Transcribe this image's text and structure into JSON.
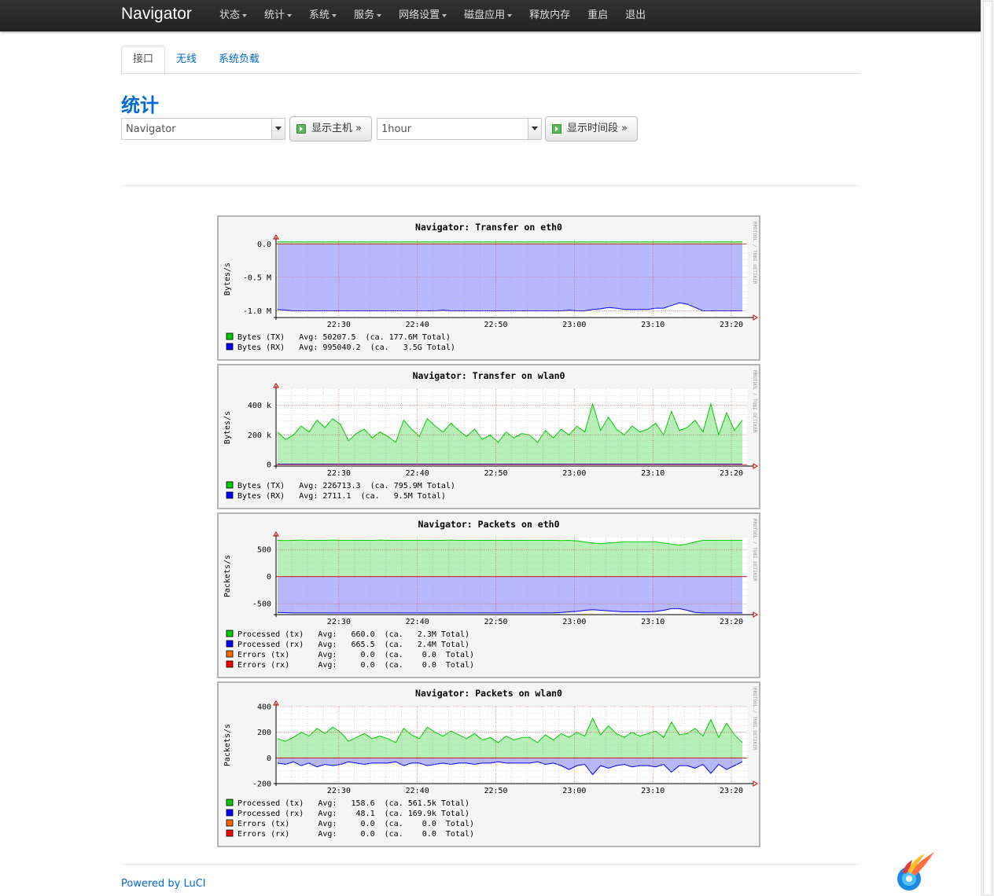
{
  "navbar": {
    "brand": "Navigator",
    "menu": [
      {
        "label": "状态",
        "dropdown": true
      },
      {
        "label": "统计",
        "dropdown": true
      },
      {
        "label": "系统",
        "dropdown": true
      },
      {
        "label": "服务",
        "dropdown": true
      },
      {
        "label": "网络设置",
        "dropdown": true
      },
      {
        "label": "磁盘应用",
        "dropdown": true
      },
      {
        "label": "释放内存",
        "dropdown": false
      },
      {
        "label": "重启",
        "dropdown": false
      },
      {
        "label": "退出",
        "dropdown": false
      }
    ]
  },
  "tabs": [
    {
      "label": "接口",
      "active": true
    },
    {
      "label": "无线",
      "active": false
    },
    {
      "label": "系统负载",
      "active": false
    }
  ],
  "page_title": "统计",
  "controls": {
    "host_select": "Navigator",
    "show_host_button": "显示主机 »",
    "timespan_select": "1hour",
    "show_timespan_button": "显示时间段 »"
  },
  "footer": {
    "powered_by": "Powered by LuCI"
  },
  "colors": {
    "accent": "#0069d6",
    "tx": "#00cc00",
    "rx": "#0000ff",
    "err_tx": "#ff6600",
    "err_rx": "#ff0000"
  },
  "chart_data": [
    {
      "type": "area",
      "title": "Navigator: Transfer on eth0",
      "ylabel": "Bytes/s",
      "y_ticks": [
        "0.0",
        "-0.5 M",
        "-1.0 M"
      ],
      "y_tick_values": [
        0,
        -0.5,
        -1.0
      ],
      "ylim": [
        -1.1,
        0.05
      ],
      "x_ticks": [
        "22:30",
        "22:40",
        "22:50",
        "23:00",
        "23:10",
        "23:20"
      ],
      "x_tick_values": [
        "22:30",
        "22:40",
        "22:50",
        "23:00",
        "23:10",
        "23:20"
      ],
      "xlim": [
        "22:22",
        "23:22"
      ],
      "watermark": "RRDTOOL / TOBI OETIKER",
      "series": [
        {
          "name": "Bytes (TX)",
          "color": "#00cc00",
          "values": [
            0.03,
            0.03,
            0.03,
            0.03,
            0.03,
            0.03,
            0.03,
            0.03,
            0.03,
            0.03,
            0.03,
            0.03,
            0.03,
            0.03,
            0.03,
            0.03,
            0.03,
            0.03,
            0.03,
            0.03,
            0.03,
            0.03,
            0.03,
            0.03,
            0.03,
            0.03,
            0.03,
            0.03,
            0.03,
            0.03,
            0.03,
            0.03,
            0.03,
            0.03,
            0.03,
            0.03,
            0.03,
            0.03,
            0.03,
            0.03,
            0.03,
            0.03,
            0.03,
            0.03,
            0.03,
            0.03,
            0.03,
            0.03,
            0.03,
            0.03,
            0.03,
            0.03,
            0.03,
            0.03,
            0.03,
            0.03,
            0.03,
            0.03,
            0.03,
            0.03
          ]
        },
        {
          "name": "Bytes (RX)",
          "color": "#0000ff",
          "values": [
            -0.98,
            -0.99,
            -1.0,
            -1.0,
            -1.0,
            -1.0,
            -1.0,
            -1.0,
            -1.0,
            -1.0,
            -1.0,
            -1.0,
            -1.0,
            -1.0,
            -1.0,
            -1.0,
            -1.0,
            -1.0,
            -1.0,
            -1.0,
            -1.0,
            -0.99,
            -1.0,
            -1.0,
            -1.0,
            -1.0,
            -1.0,
            -1.0,
            -1.0,
            -1.0,
            -1.0,
            -1.0,
            -1.0,
            -1.0,
            -1.0,
            -1.0,
            -1.0,
            -0.99,
            -1.0,
            -1.0,
            -0.98,
            -0.97,
            -0.95,
            -0.96,
            -0.98,
            -0.98,
            -0.98,
            -0.98,
            -0.96,
            -0.96,
            -0.92,
            -0.88,
            -0.9,
            -0.95,
            -1.0,
            -1.0,
            -1.0,
            -1.0,
            -1.0,
            -1.0
          ]
        }
      ],
      "legend": [
        {
          "label": "Bytes (TX)",
          "color": "#00cc00",
          "text": "Bytes (TX)   Avg: 50207.5  (ca. 177.6M Total)"
        },
        {
          "label": "Bytes (RX)",
          "color": "#0000ff",
          "text": "Bytes (RX)   Avg: 995040.2  (ca.   3.5G Total)"
        }
      ]
    },
    {
      "type": "area",
      "title": "Navigator: Transfer on wlan0",
      "ylabel": "Bytes/s",
      "y_ticks": [
        "400 k",
        "200 k",
        "0"
      ],
      "y_tick_values": [
        400,
        200,
        0
      ],
      "ylim": [
        -10,
        510
      ],
      "x_ticks": [
        "22:30",
        "22:40",
        "22:50",
        "23:00",
        "23:10",
        "23:20"
      ],
      "x_tick_values": [
        "22:30",
        "22:40",
        "22:50",
        "23:00",
        "23:10",
        "23:20"
      ],
      "xlim": [
        "22:22",
        "23:22"
      ],
      "watermark": "RRDTOOL / TOBI OETIKER",
      "series": [
        {
          "name": "Bytes (TX)",
          "color": "#00cc00",
          "values": [
            220,
            170,
            200,
            260,
            220,
            300,
            250,
            310,
            270,
            160,
            210,
            240,
            180,
            220,
            190,
            150,
            300,
            240,
            190,
            310,
            260,
            220,
            280,
            230,
            190,
            240,
            170,
            200,
            150,
            220,
            180,
            210,
            200,
            150,
            230,
            180,
            240,
            200,
            260,
            220,
            410,
            230,
            320,
            240,
            200,
            260,
            220,
            240,
            280,
            200,
            360,
            230,
            250,
            300,
            220,
            410,
            200,
            350,
            230,
            300
          ]
        },
        {
          "name": "Bytes (RX)",
          "color": "#0000ff",
          "values": [
            3,
            3,
            3,
            3,
            3,
            3,
            3,
            3,
            3,
            3,
            3,
            3,
            3,
            3,
            3,
            3,
            3,
            3,
            3,
            3,
            3,
            3,
            3,
            3,
            3,
            3,
            3,
            3,
            3,
            3,
            3,
            3,
            3,
            3,
            3,
            3,
            3,
            3,
            3,
            3,
            3,
            3,
            3,
            3,
            3,
            3,
            3,
            3,
            3,
            3,
            3,
            3,
            3,
            3,
            3,
            3,
            3,
            3,
            3,
            3
          ]
        }
      ],
      "legend": [
        {
          "label": "Bytes (TX)",
          "color": "#00cc00",
          "text": "Bytes (TX)   Avg: 226713.3  (ca. 795.9M Total)"
        },
        {
          "label": "Bytes (RX)",
          "color": "#0000ff",
          "text": "Bytes (RX)   Avg: 2711.1  (ca.   9.5M Total)"
        }
      ]
    },
    {
      "type": "area",
      "title": "Navigator: Packets on eth0",
      "ylabel": "Packets/s",
      "y_ticks": [
        "500",
        "0",
        "-500"
      ],
      "y_tick_values": [
        500,
        0,
        -500
      ],
      "ylim": [
        -700,
        720
      ],
      "x_ticks": [
        "22:30",
        "22:40",
        "22:50",
        "23:00",
        "23:10",
        "23:20"
      ],
      "x_tick_values": [
        "22:30",
        "22:40",
        "22:50",
        "23:00",
        "23:10",
        "23:20"
      ],
      "xlim": [
        "22:22",
        "23:22"
      ],
      "watermark": "RRDTOOL / TOBI OETIKER",
      "series": [
        {
          "name": "Processed (tx)",
          "color": "#00cc00",
          "values": [
            670,
            665,
            670,
            675,
            670,
            670,
            670,
            675,
            670,
            670,
            670,
            670,
            670,
            675,
            670,
            670,
            670,
            670,
            670,
            670,
            670,
            670,
            675,
            670,
            670,
            670,
            670,
            670,
            670,
            670,
            670,
            670,
            670,
            670,
            670,
            670,
            665,
            670,
            660,
            640,
            620,
            610,
            620,
            630,
            640,
            640,
            640,
            640,
            640,
            620,
            600,
            580,
            600,
            640,
            670,
            670,
            670,
            670,
            670,
            670
          ]
        },
        {
          "name": "Processed (rx)",
          "color": "#0000ff",
          "values": [
            -660,
            -665,
            -670,
            -670,
            -670,
            -670,
            -670,
            -670,
            -670,
            -670,
            -670,
            -670,
            -670,
            -670,
            -670,
            -670,
            -670,
            -670,
            -670,
            -670,
            -670,
            -670,
            -670,
            -670,
            -670,
            -670,
            -670,
            -670,
            -670,
            -670,
            -670,
            -670,
            -670,
            -670,
            -670,
            -670,
            -660,
            -650,
            -640,
            -620,
            -610,
            -620,
            -630,
            -640,
            -650,
            -650,
            -650,
            -650,
            -640,
            -620,
            -590,
            -590,
            -620,
            -660,
            -670,
            -670,
            -670,
            -670,
            -670,
            -670
          ]
        },
        {
          "name": "Errors (tx)",
          "color": "#ff6600",
          "values": [
            0,
            0,
            0,
            0,
            0,
            0,
            0,
            0,
            0,
            0,
            0,
            0,
            0,
            0,
            0,
            0,
            0,
            0,
            0,
            0,
            0,
            0,
            0,
            0,
            0,
            0,
            0,
            0,
            0,
            0,
            0,
            0,
            0,
            0,
            0,
            0,
            0,
            0,
            0,
            0,
            0,
            0,
            0,
            0,
            0,
            0,
            0,
            0,
            0,
            0,
            0,
            0,
            0,
            0,
            0,
            0,
            0,
            0,
            0,
            0
          ]
        },
        {
          "name": "Errors (rx)",
          "color": "#ff0000",
          "values": [
            0,
            0,
            0,
            0,
            0,
            0,
            0,
            0,
            0,
            0,
            0,
            0,
            0,
            0,
            0,
            0,
            0,
            0,
            0,
            0,
            0,
            0,
            0,
            0,
            0,
            0,
            0,
            0,
            0,
            0,
            0,
            0,
            0,
            0,
            0,
            0,
            0,
            0,
            0,
            0,
            0,
            0,
            0,
            0,
            0,
            0,
            0,
            0,
            0,
            0,
            0,
            0,
            0,
            0,
            0,
            0,
            0,
            0,
            0,
            0
          ]
        }
      ],
      "legend": [
        {
          "label": "Processed (tx)",
          "color": "#00cc00",
          "text": "Processed (tx)   Avg:   660.0  (ca.   2.3M Total)"
        },
        {
          "label": "Processed (rx)",
          "color": "#0000ff",
          "text": "Processed (rx)   Avg:   665.5  (ca.   2.4M Total)"
        },
        {
          "label": "Errors (tx)",
          "color": "#ff6600",
          "text": "Errors (tx)      Avg:     0.0  (ca.    0.0  Total)"
        },
        {
          "label": "Errors (rx)",
          "color": "#ff0000",
          "text": "Errors (rx)      Avg:     0.0  (ca.    0.0  Total)"
        }
      ]
    },
    {
      "type": "area",
      "title": "Navigator: Packets on wlan0",
      "ylabel": "Packets/s",
      "y_ticks": [
        "400",
        "200",
        "0",
        "-200"
      ],
      "y_tick_values": [
        400,
        200,
        0,
        -200
      ],
      "ylim": [
        -200,
        400
      ],
      "x_ticks": [
        "22:30",
        "22:40",
        "22:50",
        "23:00",
        "23:10",
        "23:20"
      ],
      "x_tick_values": [
        "22:30",
        "22:40",
        "22:50",
        "23:00",
        "23:10",
        "23:20"
      ],
      "xlim": [
        "22:22",
        "23:22"
      ],
      "watermark": "RRDTOOL / TOBI OETIKER",
      "series": [
        {
          "name": "Processed (tx)",
          "color": "#00cc00",
          "values": [
            150,
            130,
            160,
            200,
            170,
            230,
            190,
            240,
            200,
            130,
            160,
            190,
            150,
            170,
            150,
            120,
            230,
            180,
            150,
            240,
            200,
            170,
            210,
            180,
            150,
            190,
            140,
            160,
            120,
            170,
            140,
            160,
            160,
            120,
            180,
            140,
            190,
            160,
            200,
            170,
            310,
            180,
            250,
            190,
            160,
            200,
            170,
            190,
            210,
            160,
            280,
            180,
            190,
            230,
            170,
            300,
            160,
            270,
            180,
            120
          ]
        },
        {
          "name": "Processed (rx)",
          "color": "#0000ff",
          "values": [
            -40,
            -50,
            -30,
            -60,
            -40,
            -70,
            -50,
            -60,
            -50,
            -30,
            -40,
            -50,
            -40,
            -40,
            -40,
            -30,
            -60,
            -40,
            -40,
            -60,
            -50,
            -40,
            -50,
            -40,
            -40,
            -50,
            -40,
            -40,
            -30,
            -40,
            -40,
            -40,
            -40,
            -30,
            -50,
            -40,
            -60,
            -90,
            -60,
            -50,
            -130,
            -60,
            -80,
            -60,
            -50,
            -70,
            -60,
            -60,
            -70,
            -50,
            -110,
            -60,
            -60,
            -80,
            -50,
            -120,
            -50,
            -90,
            -60,
            -30
          ]
        },
        {
          "name": "Errors (tx)",
          "color": "#ff6600",
          "values": [
            0,
            0,
            0,
            0,
            0,
            0,
            0,
            0,
            0,
            0,
            0,
            0,
            0,
            0,
            0,
            0,
            0,
            0,
            0,
            0,
            0,
            0,
            0,
            0,
            0,
            0,
            0,
            0,
            0,
            0,
            0,
            0,
            0,
            0,
            0,
            0,
            0,
            0,
            0,
            0,
            0,
            0,
            0,
            0,
            0,
            0,
            0,
            0,
            0,
            0,
            0,
            0,
            0,
            0,
            0,
            0,
            0,
            0,
            0,
            0
          ]
        },
        {
          "name": "Errors (rx)",
          "color": "#ff0000",
          "values": [
            0,
            0,
            0,
            0,
            0,
            0,
            0,
            0,
            0,
            0,
            0,
            0,
            0,
            0,
            0,
            0,
            0,
            0,
            0,
            0,
            0,
            0,
            0,
            0,
            0,
            0,
            0,
            0,
            0,
            0,
            0,
            0,
            0,
            0,
            0,
            0,
            0,
            0,
            0,
            0,
            0,
            0,
            0,
            0,
            0,
            0,
            0,
            0,
            0,
            0,
            0,
            0,
            0,
            0,
            0,
            0,
            0,
            0,
            0,
            0
          ]
        }
      ],
      "legend": [
        {
          "label": "Processed (tx)",
          "color": "#00cc00",
          "text": "Processed (tx)   Avg:   158.6  (ca. 561.5k Total)"
        },
        {
          "label": "Processed (rx)",
          "color": "#0000ff",
          "text": "Processed (rx)   Avg:    48.1  (ca. 169.9k Total)"
        },
        {
          "label": "Errors (tx)",
          "color": "#ff6600",
          "text": "Errors (tx)      Avg:     0.0  (ca.    0.0  Total)"
        },
        {
          "label": "Errors (rx)",
          "color": "#ff0000",
          "text": "Errors (rx)      Avg:     0.0  (ca.    0.0  Total)"
        }
      ]
    }
  ]
}
